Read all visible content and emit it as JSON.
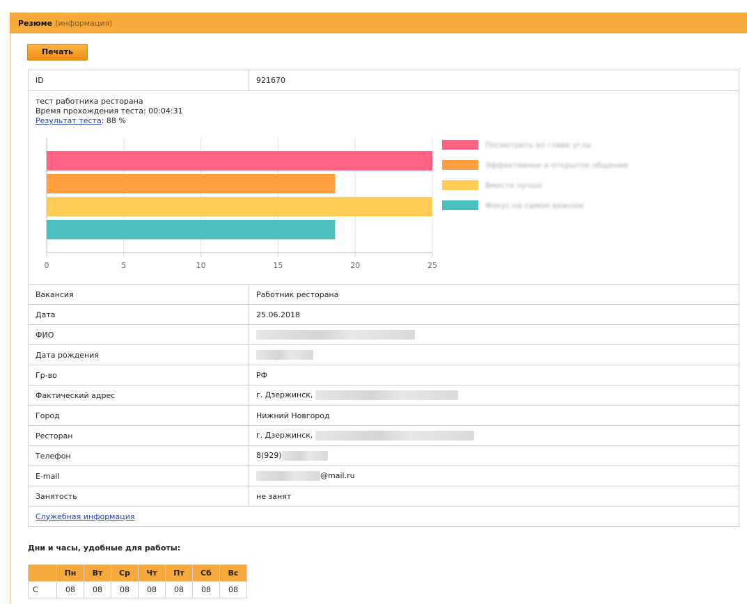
{
  "header": {
    "title": "Резюме",
    "subtitle": "(информация)"
  },
  "toolbar": {
    "print_label": "Печать"
  },
  "test": {
    "id_label": "ID",
    "id_value": "921670",
    "name": "тест работника ресторана",
    "time_label": "Время прохождения теста: 00:04:31",
    "result_link": "Результат теста",
    "result_value": ": 88 %"
  },
  "chart_data": {
    "type": "bar",
    "orientation": "horizontal",
    "series": [
      {
        "name": "Посмотреть во главе угла",
        "value": 25,
        "color": "#ff6384"
      },
      {
        "name": "Эффективное и открытое общение",
        "value": 18.7,
        "color": "#ff9f40"
      },
      {
        "name": "Вместе лучше",
        "value": 25,
        "color": "#ffcd56"
      },
      {
        "name": "Фокус на самом важном",
        "value": 18.7,
        "color": "#4bc0c0"
      }
    ],
    "xticks": [
      "0",
      "5",
      "10",
      "15",
      "20",
      "25"
    ],
    "xlim": [
      0,
      25
    ],
    "grid": true,
    "legend_position": "right"
  },
  "fields": [
    {
      "label": "Вакансия",
      "value": "Работник ресторана"
    },
    {
      "label": "Дата",
      "value": "25.06.2018"
    },
    {
      "label": "ФИО",
      "value": ""
    },
    {
      "label": "Дата рождения",
      "value": ""
    },
    {
      "label": "Гр-во",
      "value": "РФ"
    },
    {
      "label": "Фактический адрес",
      "value": "г. Дзержинск,"
    },
    {
      "label": "Город",
      "value": "Нижний Новгород"
    },
    {
      "label": "Ресторан",
      "value": "г. Дзержинск,"
    },
    {
      "label": "Телефон",
      "value": "8(929)"
    },
    {
      "label": "E-mail",
      "value": "@mail.ru"
    },
    {
      "label": "Занятость",
      "value": "не занят"
    }
  ],
  "service_link": "Служебная информация",
  "schedule": {
    "title": "Дни и часы, удобные для работы:",
    "days": [
      "Пн",
      "Вт",
      "Ср",
      "Чт",
      "Пт",
      "Сб",
      "Вс"
    ],
    "row_label": "С",
    "values": [
      "08",
      "08",
      "08",
      "08",
      "08",
      "08",
      "08"
    ]
  }
}
